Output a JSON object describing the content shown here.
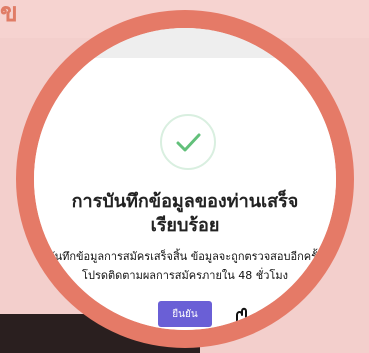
{
  "corner_text": "ข",
  "modal": {
    "title_line1": "การบันทึกข้อมูลของท่านเสร็จ",
    "title_line2": "เรียบร้อย",
    "desc_line1": "บันทึกข้อมูลการสมัครเสร็จสิ้น ข้อมูลจะถูกตรวจสอบอีกครั้ง",
    "desc_line2": "โปรดติดตามผลการสมัครภายใน 48 ชั่วโมง",
    "confirm_label": "ยืนยัน"
  },
  "icons": {
    "success": "check-icon",
    "pointer": "hand-cursor-icon"
  },
  "colors": {
    "ring": "#e57a67",
    "background": "#f6d3d0",
    "check": "#62c07a",
    "button": "#6a5fd6"
  }
}
